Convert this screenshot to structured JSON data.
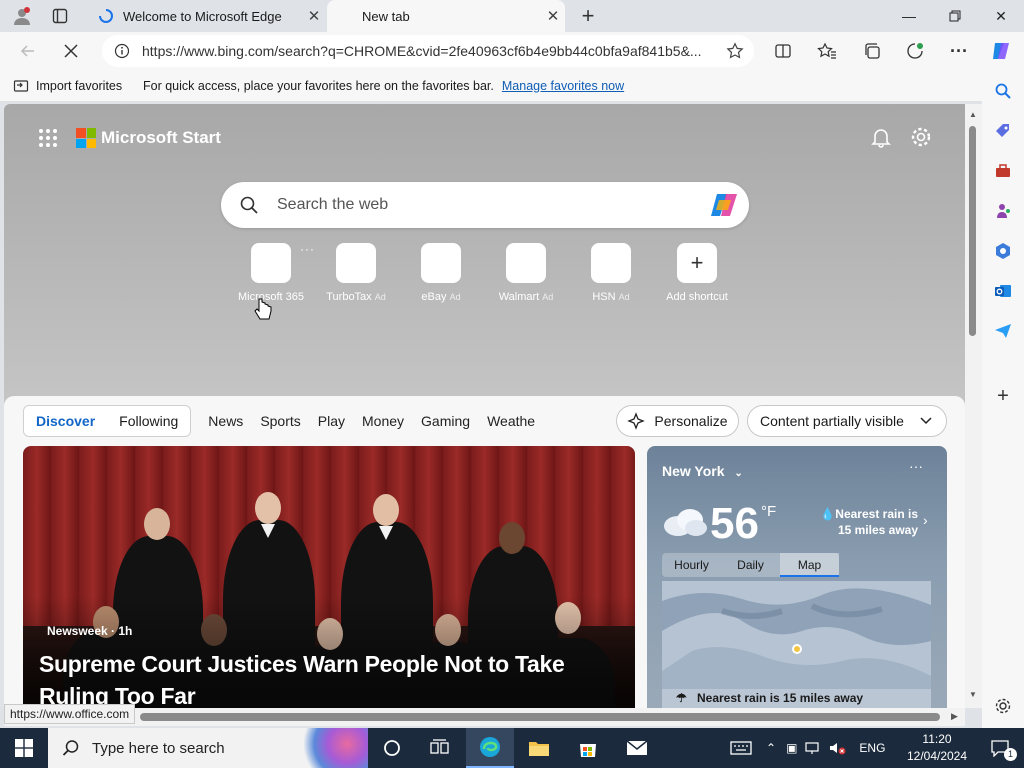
{
  "browser": {
    "tabs": [
      {
        "title": "Welcome to Microsoft Edge"
      },
      {
        "title": "New tab"
      }
    ],
    "url": "https://www.bing.com/search?q=CHROME&cvid=2fe40963cf6b4e9bb44c0bfa9af841b5&...",
    "favorites_bar": {
      "import_label": "Import favorites",
      "message": "For quick access, place your favorites here on the favorites bar.",
      "link": "Manage favorites now"
    },
    "status_url": "https://www.office.com"
  },
  "page": {
    "brand": "Microsoft Start",
    "search_placeholder": "Search the web",
    "shortcuts": [
      {
        "label": "Microsoft 365",
        "ad": ""
      },
      {
        "label": "TurboTax",
        "ad": "Ad"
      },
      {
        "label": "eBay",
        "ad": "Ad"
      },
      {
        "label": "Walmart",
        "ad": "Ad"
      },
      {
        "label": "HSN",
        "ad": "Ad"
      },
      {
        "label": "Add shortcut",
        "ad": ""
      }
    ],
    "feed_tabs": {
      "discover": "Discover",
      "following": "Following",
      "news": "News",
      "sports": "Sports",
      "play": "Play",
      "money": "Money",
      "gaming": "Gaming",
      "weather": "Weathe"
    },
    "personalize": "Personalize",
    "content_visibility": "Content partially visible",
    "news_card": {
      "source": "Newsweek · 1h",
      "headline": "Supreme Court Justices Warn People Not to Take Ruling Too Far"
    },
    "weather_card": {
      "city": "New York",
      "temperature": "56",
      "unit": "°F",
      "rain_note": "Nearest rain is 15 miles away",
      "tabs": [
        "Hourly",
        "Daily",
        "Map"
      ],
      "active_tab": "Map",
      "map_note": "Nearest rain is 15 miles away"
    }
  },
  "taskbar": {
    "search_placeholder": "Type here to search",
    "language": "ENG",
    "time": "11:20",
    "date": "12/04/2024",
    "notifications": "1"
  },
  "colors": {
    "accent": "#1266c7",
    "link": "#0f5eb5",
    "taskbar": "#1b2a3c"
  }
}
